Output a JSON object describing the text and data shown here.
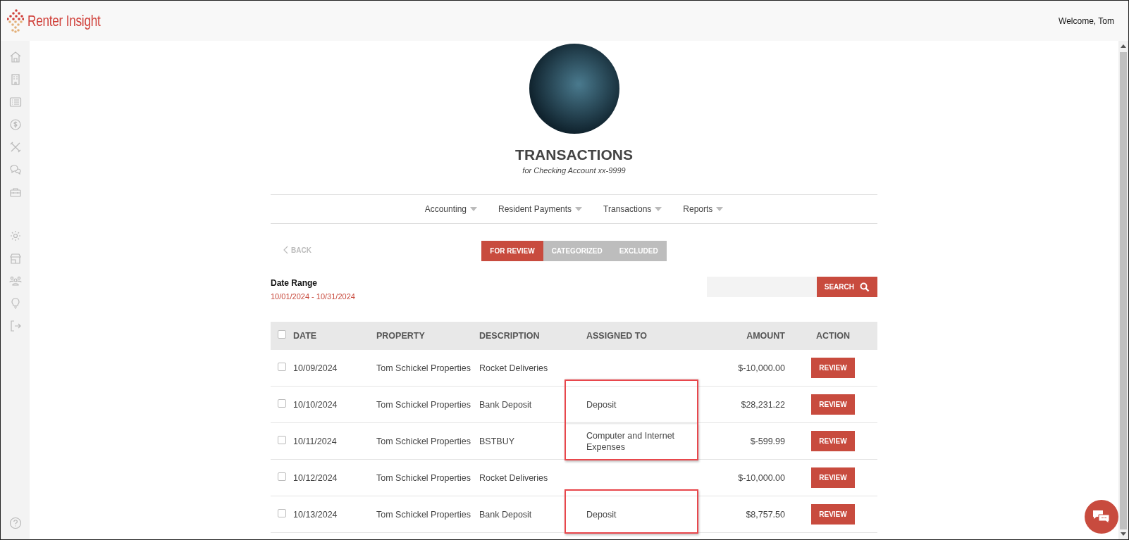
{
  "header": {
    "logo": "Renter Insight",
    "welcome": "Welcome, Tom"
  },
  "page": {
    "title": "TRANSACTIONS",
    "subtitle": "for Checking Account xx-9999"
  },
  "nav": [
    "Accounting",
    "Resident Payments",
    "Transactions",
    "Reports"
  ],
  "back": "BACK",
  "tabs": [
    {
      "label": "FOR REVIEW",
      "selected": true
    },
    {
      "label": "CATEGORIZED",
      "selected": false
    },
    {
      "label": "EXCLUDED",
      "selected": false
    }
  ],
  "date_range": {
    "label": "Date Range",
    "value": "10/01/2024 - 10/31/2024"
  },
  "search": {
    "button": "SEARCH"
  },
  "table": {
    "columns": [
      "DATE",
      "PROPERTY",
      "DESCRIPTION",
      "ASSIGNED TO",
      "AMOUNT",
      "ACTION"
    ],
    "select_all_checked": false,
    "rows": [
      {
        "date": "10/09/2024",
        "property": "Tom Schickel Properties",
        "description": "Rocket Deliveries",
        "assigned_to": "",
        "amount": "$-10,000.00",
        "action": "REVIEW",
        "checked": false,
        "highlighted": false
      },
      {
        "date": "10/10/2024",
        "property": "Tom Schickel Properties",
        "description": "Bank Deposit",
        "assigned_to": "Deposit",
        "amount": "$28,231.22",
        "action": "REVIEW",
        "checked": false,
        "highlighted": true
      },
      {
        "date": "10/11/2024",
        "property": "Tom Schickel Properties",
        "description": "BSTBUY",
        "assigned_to": "Computer and Internet Expenses",
        "amount": "$-599.99",
        "action": "REVIEW",
        "checked": false,
        "highlighted": true
      },
      {
        "date": "10/12/2024",
        "property": "Tom Schickel Properties",
        "description": "Rocket Deliveries",
        "assigned_to": "",
        "amount": "$-10,000.00",
        "action": "REVIEW",
        "checked": false,
        "highlighted": false
      },
      {
        "date": "10/13/2024",
        "property": "Tom Schickel Properties",
        "description": "Bank Deposit",
        "assigned_to": "Deposit",
        "amount": "$8,757.50",
        "action": "REVIEW",
        "checked": false,
        "highlighted": true
      }
    ]
  }
}
